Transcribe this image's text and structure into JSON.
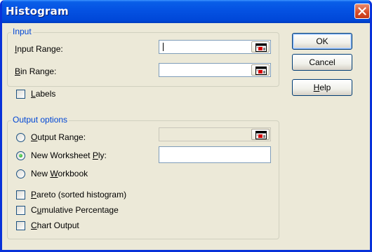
{
  "window": {
    "title": "Histogram",
    "accent_color": "#0553e3",
    "close_icon": "close-icon"
  },
  "input_group": {
    "title": "Input",
    "input_range": {
      "label_u": "I",
      "label_rest": "nput Range:",
      "value": ""
    },
    "bin_range": {
      "label_u": "B",
      "label_rest": "in Range:",
      "value": ""
    }
  },
  "labels_checkbox": {
    "label_u": "L",
    "label_rest": "abels",
    "checked": false
  },
  "output_group": {
    "title": "Output options",
    "output_range": {
      "label_u": "O",
      "label_rest": "utput Range:",
      "selected": false,
      "value": ""
    },
    "new_worksheet": {
      "label_pre": "New Worksheet ",
      "label_u": "P",
      "label_post": "ly:",
      "selected": true,
      "value": ""
    },
    "new_workbook": {
      "label_pre": "New ",
      "label_u": "W",
      "label_post": "orkbook",
      "selected": false
    },
    "pareto": {
      "label_u": "P",
      "label_rest": "areto (sorted histogram)",
      "checked": false
    },
    "cumulative": {
      "label_pre": "C",
      "label_u": "u",
      "label_post": "mulative Percentage",
      "checked": false
    },
    "chart_output": {
      "label_u": "C",
      "label_rest": "hart Output",
      "checked": false
    }
  },
  "buttons": {
    "ok": "OK",
    "cancel": "Cancel",
    "help_u": "H",
    "help_rest": "elp"
  }
}
